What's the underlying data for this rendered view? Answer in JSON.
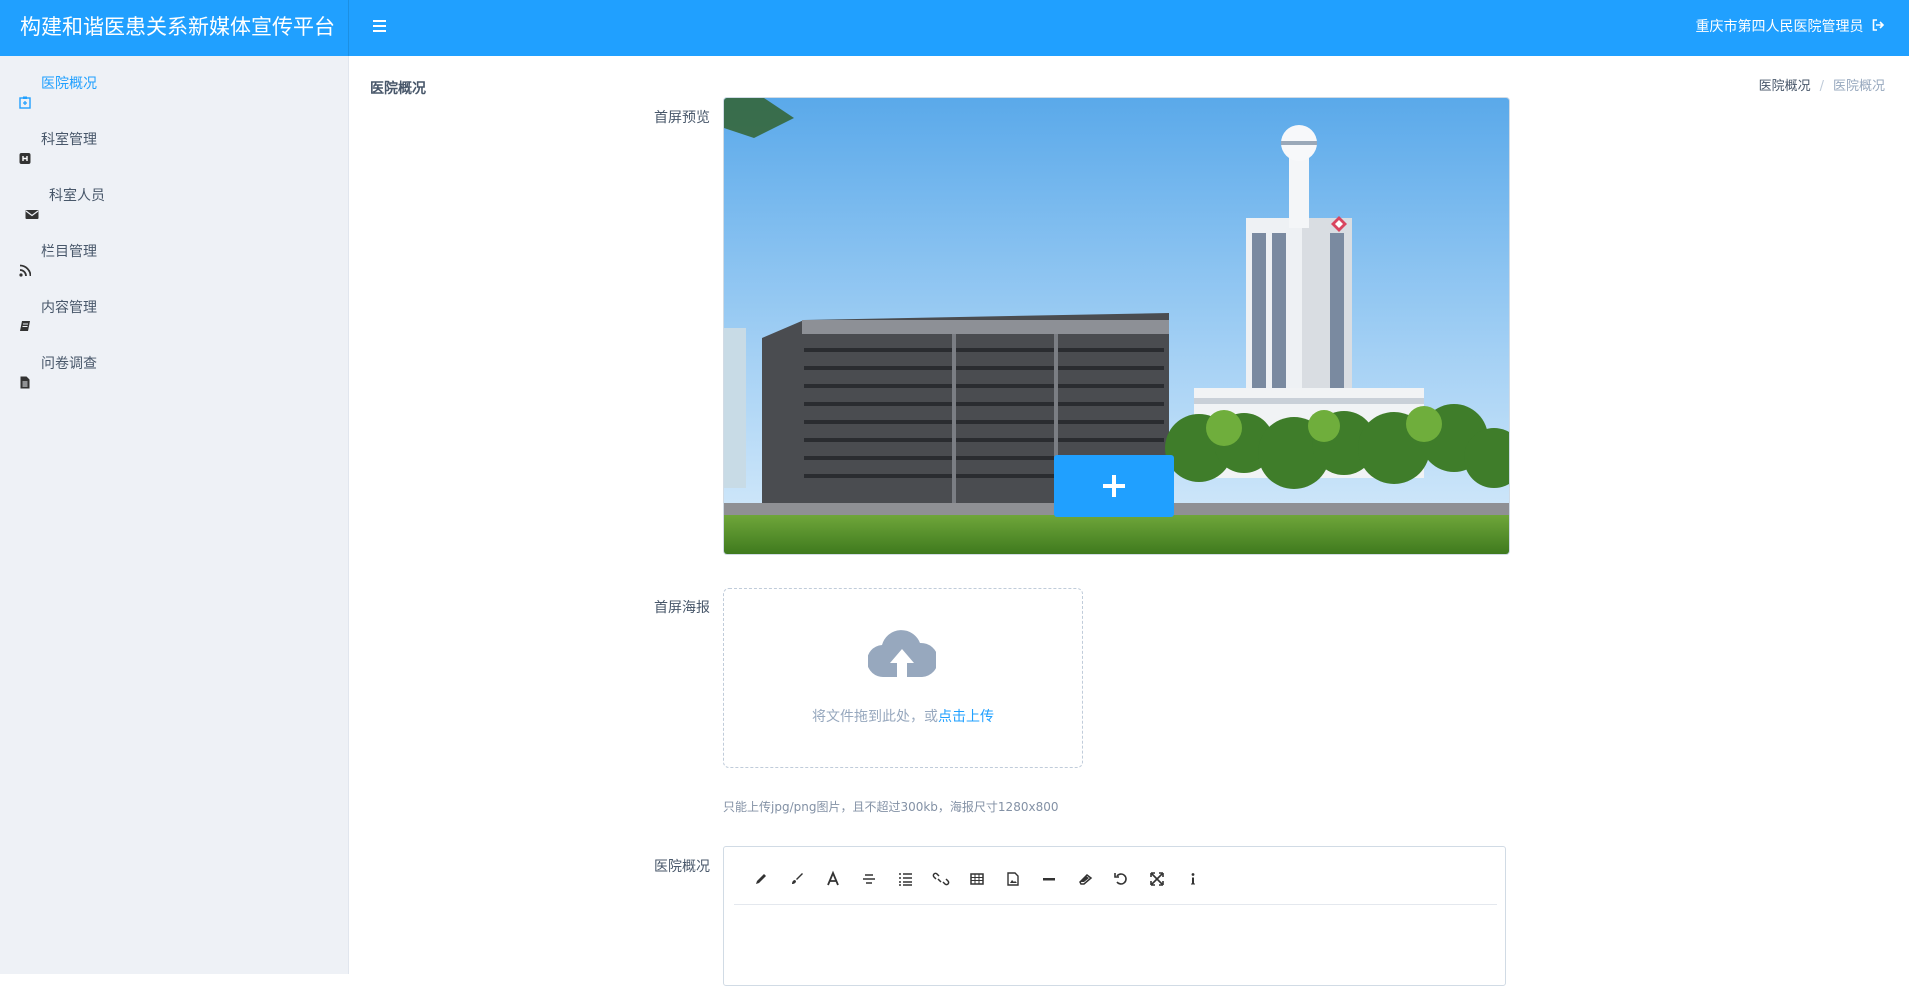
{
  "header": {
    "brand": "构建和谐医患关系新媒体宣传平台",
    "user": "重庆市第四人民医院管理员",
    "menu_icon": "hamburger-icon",
    "logout_icon": "sign-out-icon",
    "bar_color": "#20a0ff"
  },
  "sidebar": {
    "items": [
      {
        "label": "医院概况",
        "icon": "hospital-icon",
        "active": true
      },
      {
        "label": "科室管理",
        "icon": "h-square-icon",
        "active": false
      },
      {
        "label": "科室人员",
        "icon": "envelope-icon",
        "active": false
      },
      {
        "label": "栏目管理",
        "icon": "rss-icon",
        "active": false
      },
      {
        "label": "内容管理",
        "icon": "book-icon",
        "active": false
      },
      {
        "label": "问卷调查",
        "icon": "file-text-icon",
        "active": false
      }
    ],
    "active_color": "#20a0ff"
  },
  "page": {
    "title": "医院概况",
    "breadcrumb": [
      "医院概况",
      "医院概况"
    ],
    "breadcrumb_separator": "/"
  },
  "form": {
    "preview_label": "首屏预览",
    "poster_label": "首屏海报",
    "overview_label": "医院概况",
    "preview_image": "hospital-buildings-photo",
    "upload_button_icon": "plus-icon",
    "dropzone_icon": "cloud-upload-icon",
    "dropzone_text": "将文件拖到此处，或",
    "dropzone_link": "点击上传",
    "upload_tip": "只能上传jpg/png图片，且不超过300kb，海报尺寸1280x800"
  },
  "editor": {
    "toolbar_icons": [
      "pencil-icon",
      "paint-brush-icon",
      "font-icon",
      "strikethrough-icon",
      "list-icon",
      "unlink-icon",
      "table-icon",
      "image-icon",
      "minus-icon",
      "eraser-icon",
      "undo-icon",
      "expand-icon",
      "info-icon"
    ]
  }
}
